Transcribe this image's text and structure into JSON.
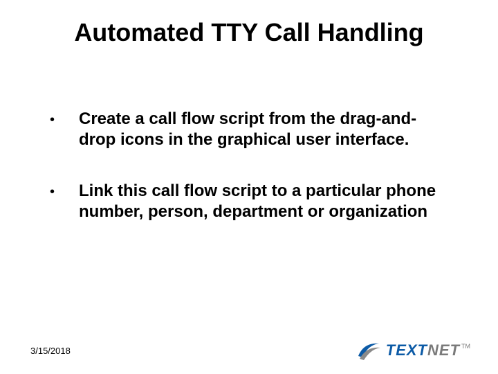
{
  "title": "Automated TTY Call Handling",
  "bullets": [
    "Create a call flow script from the drag-and-drop icons in the graphical user interface.",
    "Link this call flow script to a particular phone number, person, department or organization"
  ],
  "footer": {
    "date": "3/15/2018",
    "logo": {
      "word1": "TEXT",
      "word2": "NET",
      "tm": "TM"
    }
  }
}
